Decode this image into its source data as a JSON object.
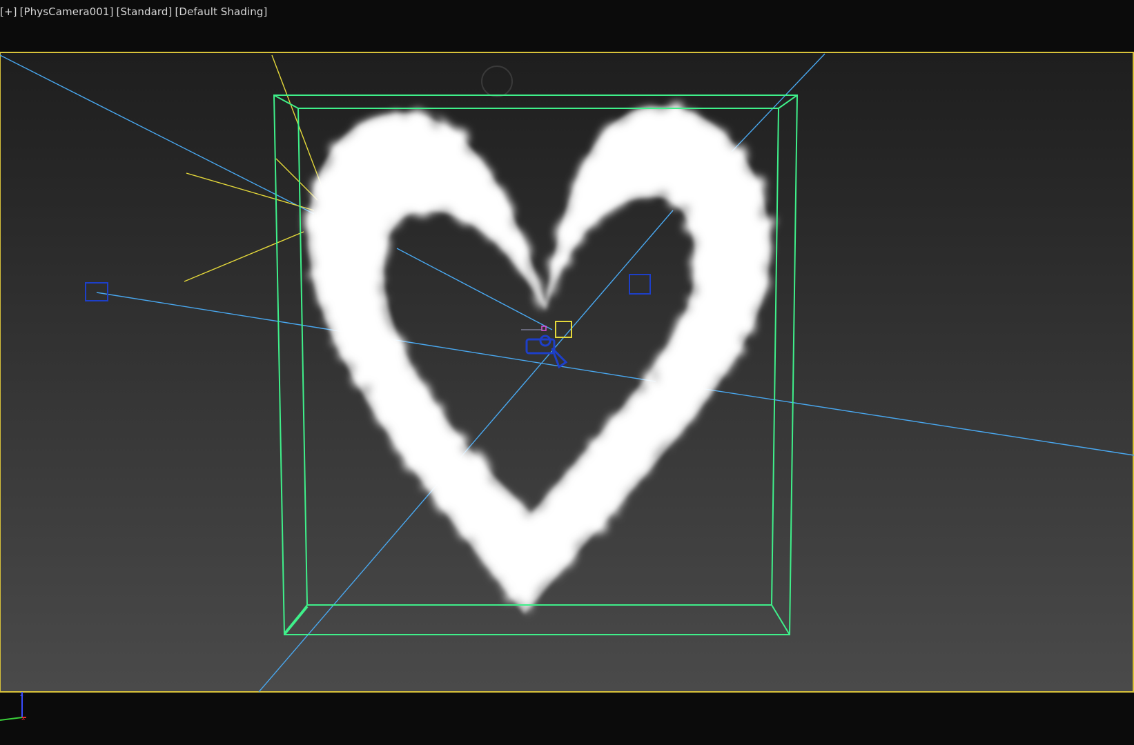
{
  "viewport": {
    "label_items": [
      "[+]",
      "[PhysCamera001]",
      "[Standard]",
      "[Default Shading]"
    ],
    "active_border_color": "#d8c23a",
    "background_top": "#1f1f1f",
    "background_bottom": "#4a4a4a"
  },
  "scene": {
    "cloud_shape": "heart",
    "cloud_color": "#ffffff",
    "bounding_box_color": "#3ff08a",
    "helper_line_color": "#49a8f0",
    "light_color": "#e5d93a",
    "gizmo_color": "#1d3fc9"
  },
  "axis_tripod": {
    "icon": "axis-tripod-icon",
    "z_color": "#3a4cff",
    "x_color": "#e03030",
    "y_color": "#3ad03a"
  }
}
